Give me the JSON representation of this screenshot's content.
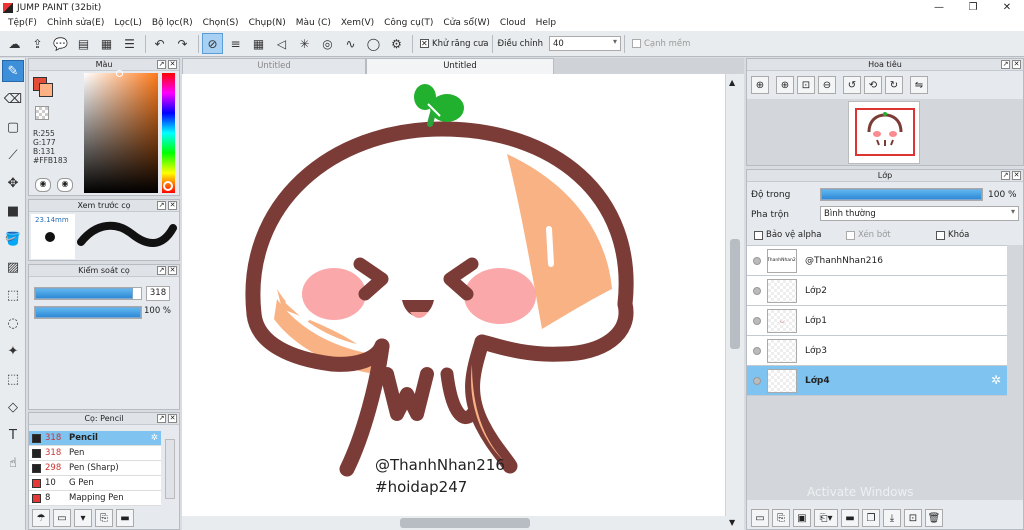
{
  "window": {
    "title": "JUMP PAINT (32bit)",
    "min": "—",
    "restore": "❐",
    "close": "✕"
  },
  "menu": [
    "Tệp(F)",
    "Chỉnh sửa(E)",
    "Lọc(L)",
    "Bộ lọc(R)",
    "Chọn(S)",
    "Chụp(N)",
    "Màu (C)",
    "Xem(V)",
    "Công cụ(T)",
    "Cửa sổ(W)",
    "Cloud",
    "Help"
  ],
  "toolbar": {
    "antialias_label": "Khử răng cưa",
    "correction_label": "Điều chỉnh",
    "correction_value": "40",
    "ruler_label": "Cạnh mềm"
  },
  "color_panel": {
    "title": "Màu",
    "r": "R:255",
    "g": "G:177",
    "b": "B:131",
    "hex": "#FFB183",
    "accent": "#FFB183"
  },
  "brush_preview": {
    "title": "Xem trước cọ",
    "size": "23.14mm"
  },
  "brush_control": {
    "title": "Kiểm soát cọ",
    "size": "318",
    "opacity": "100 %",
    "size_level": 0.92,
    "opacity_level": 1.0
  },
  "brush_list": {
    "title": "Cọ: Pencil",
    "items": [
      {
        "size": "318",
        "name": "Pencil",
        "color": "#222222",
        "selected": true
      },
      {
        "size": "318",
        "name": "Pen",
        "color": "#222222",
        "selected": false
      },
      {
        "size": "298",
        "name": "Pen (Sharp)",
        "color": "#222222",
        "selected": false
      },
      {
        "size": "10",
        "name": "G Pen",
        "color": "#e53935",
        "selected": false
      },
      {
        "size": "8",
        "name": "Mapping Pen",
        "color": "#e53935",
        "selected": false
      }
    ]
  },
  "canvas": {
    "tabs": [
      {
        "label": "Untitled",
        "active": false
      },
      {
        "label": "Untitled",
        "active": true
      }
    ],
    "text_line1": "@ThanhNhan216",
    "text_line2": "#hoidap247"
  },
  "navigator": {
    "title": "Hoa tiêu"
  },
  "layers": {
    "title": "Lớp",
    "opacity_label": "Độ trong",
    "opacity_value": "100 %",
    "opacity_level": 1.0,
    "blend_label": "Pha trộn",
    "blend_value": "Bình thường",
    "protect_alpha": "Bảo vệ alpha",
    "clip": "Xén bớt",
    "lock": "Khóa",
    "items": [
      {
        "name": "@ThanhNhan216",
        "thumb": "@ThanhNhan216",
        "selected": false
      },
      {
        "name": "Lớp2",
        "thumb": "",
        "selected": false
      },
      {
        "name": "Lớp1",
        "thumb": "◡",
        "selected": false
      },
      {
        "name": "Lớp3",
        "thumb": "",
        "selected": false
      },
      {
        "name": "Lớp4",
        "thumb": "",
        "selected": true
      }
    ]
  },
  "watermark": "Activate Windows"
}
